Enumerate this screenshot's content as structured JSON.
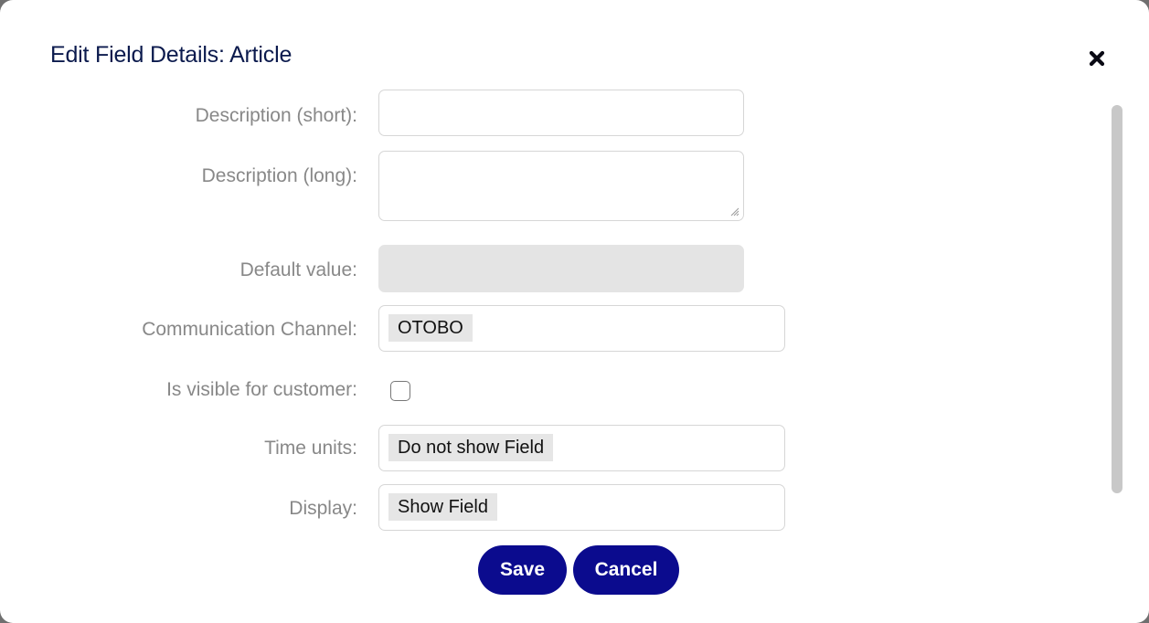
{
  "dialog": {
    "title": "Edit Field Details: Article",
    "close_icon": "close-icon"
  },
  "form": {
    "description_short": {
      "label": "Description (short):",
      "value": ""
    },
    "description_long": {
      "label": "Description (long):",
      "value": ""
    },
    "default_value": {
      "label": "Default value:",
      "value": ""
    },
    "communication_channel": {
      "label": "Communication Channel:",
      "selected": "OTOBO"
    },
    "visible_for_customer": {
      "label": "Is visible for customer:",
      "checked": false
    },
    "time_units": {
      "label": "Time units:",
      "selected": "Do not show Field"
    },
    "display": {
      "label": "Display:",
      "selected": "Show Field"
    }
  },
  "actions": {
    "save_label": "Save",
    "cancel_label": "Cancel"
  },
  "colors": {
    "title": "#0b1a4d",
    "label": "#888888",
    "button_bg": "#0b0b8e",
    "button_text": "#ffffff"
  }
}
